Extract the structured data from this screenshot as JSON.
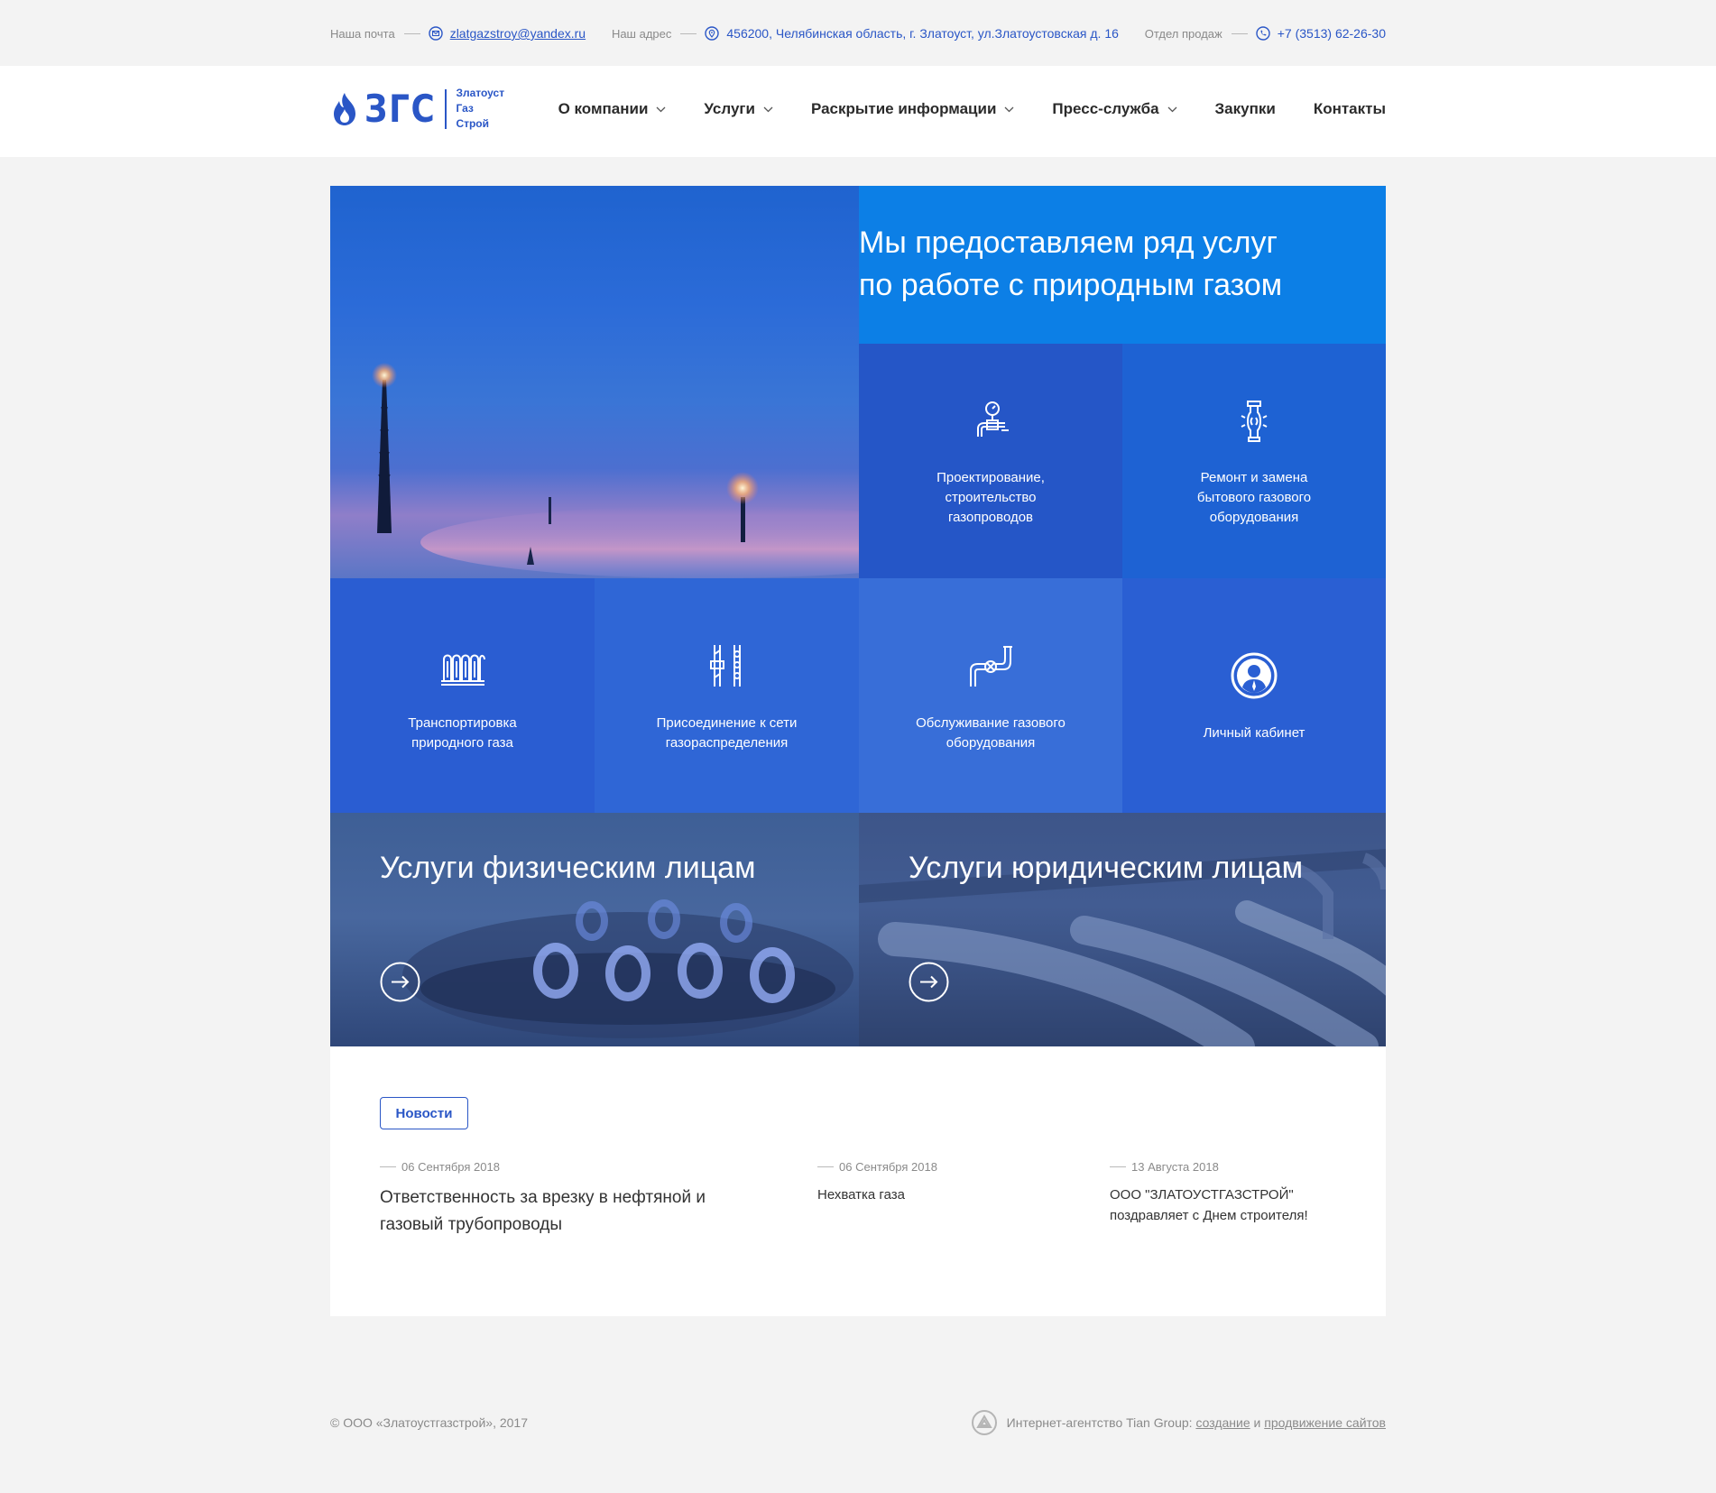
{
  "topbar": {
    "mail_label": "Наша почта",
    "mail_value": "zlatgazstroy@yandex.ru",
    "address_label": "Наш адрес",
    "address_value": "456200, Челябинская область, г. Златоуст, ул.Златоустовская д. 16",
    "sales_label": "Отдел продаж",
    "sales_value": "+7 (3513) 62-26-30"
  },
  "logo": {
    "mark": "ЗГС",
    "line1": "Златоуст",
    "line2": "Газ",
    "line3": "Строй"
  },
  "nav": [
    {
      "label": "О компании"
    },
    {
      "label": "Услуги"
    },
    {
      "label": "Раскрытие информации"
    },
    {
      "label": "Пресс-служба"
    },
    {
      "label": "Закупки"
    },
    {
      "label": "Контакты"
    }
  ],
  "hero": {
    "title_line1": "Мы предоставляем ряд услуг",
    "title_line2": "по работе с природным газом"
  },
  "tiles": [
    {
      "icon": "gauge-pipe-icon",
      "line1": "Проектирование,",
      "line2": "строительство",
      "line3": "газопроводов"
    },
    {
      "icon": "gas-cylinder-repair-icon",
      "line1": "Ремонт и замена",
      "line2": "бытового газового",
      "line3": "оборудования"
    },
    {
      "icon": "gas-tanks-icon",
      "line1": "Транспортировка",
      "line2": "природного газа"
    },
    {
      "icon": "pipe-connection-icon",
      "line1": "Присоединение к сети",
      "line2": "газораспределения"
    },
    {
      "icon": "pipe-valve-icon",
      "line1": "Обслуживание газового",
      "line2": "оборудования"
    },
    {
      "icon": "user-cabinet-icon",
      "line1": "Личный кабинет"
    }
  ],
  "promos": [
    {
      "title": "Услуги физическим лицам"
    },
    {
      "title": "Услуги юридическим лицам"
    }
  ],
  "news": {
    "button": "Новости",
    "items": [
      {
        "date": "06 Сентября 2018",
        "line1": "Ответственность за врезку в нефтяной и",
        "line2": "газовый трубопроводы"
      },
      {
        "date": "06 Сентября 2018",
        "line1": "Нехватка газа"
      },
      {
        "date": "13 Августа 2018",
        "line1": "ООО \"ЗЛАТОУСТГАЗСТРОЙ\"",
        "line2": "поздравляет с Днем строителя!"
      }
    ]
  },
  "footer": {
    "copyright": "© ООО «Златоустгазстрой», 2017",
    "agency_text": "Интернет-агентство Tian Group:",
    "link1": "создание",
    "and": "и",
    "link2": "продвижение сайтов"
  },
  "colors": {
    "brand": "#2a56c6",
    "hero_head": "#0c7fe6",
    "tile_dark": "#2556c7",
    "page_bg": "#f3f3f3"
  }
}
